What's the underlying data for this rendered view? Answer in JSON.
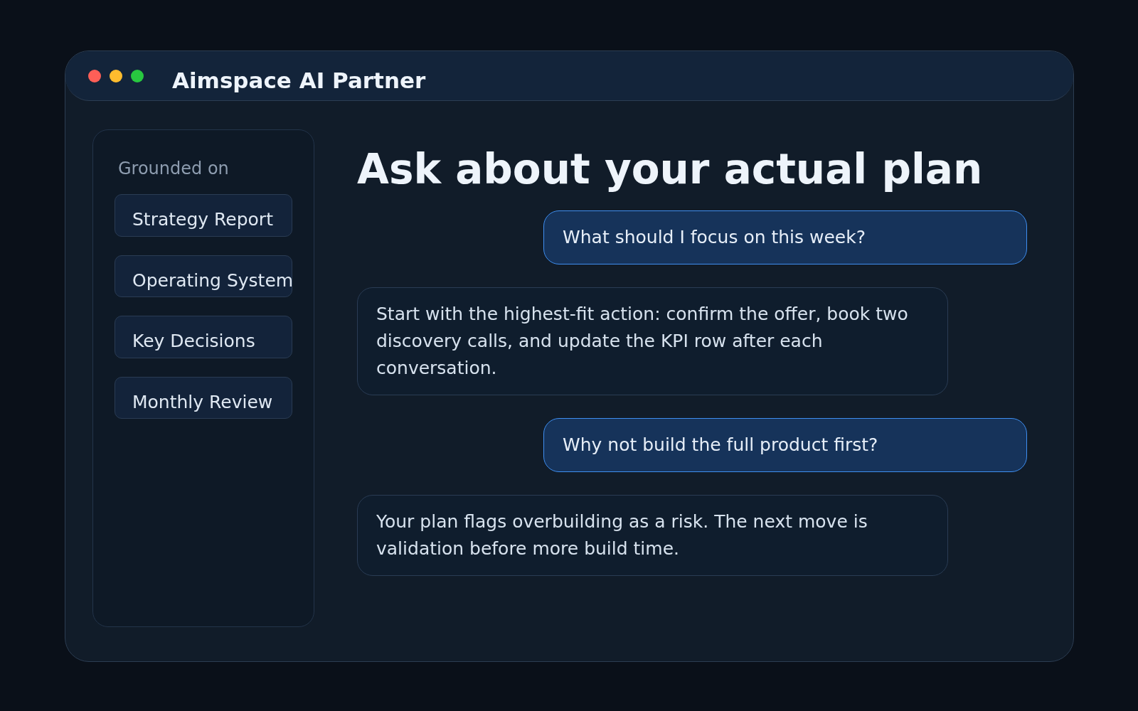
{
  "window": {
    "title": "Aimspace AI Partner"
  },
  "sidebar": {
    "heading": "Grounded on",
    "items": [
      {
        "label": "Strategy Report"
      },
      {
        "label": "Operating System"
      },
      {
        "label": "Key Decisions"
      },
      {
        "label": "Monthly Review"
      }
    ]
  },
  "main": {
    "heading": "Ask about your actual plan",
    "messages": [
      {
        "kind": "user",
        "text": "What should I focus on this week?"
      },
      {
        "kind": "assistant",
        "text": "Start with the highest-fit action: confirm the offer, book two discovery calls, and update the KPI row after each conversation."
      },
      {
        "kind": "user",
        "text": "Why not build the full product first?"
      },
      {
        "kind": "assistant",
        "text": "Your plan flags overbuilding as a risk. The next move is validation before more build time."
      }
    ]
  }
}
